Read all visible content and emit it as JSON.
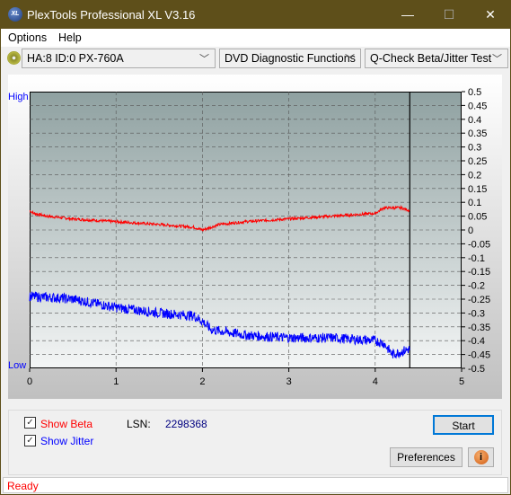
{
  "window": {
    "title": "PlexTools Professional XL V3.16",
    "logo_text": "XL",
    "minimize": "—",
    "maximize": "☐",
    "close": "✕"
  },
  "menu": {
    "options": "Options",
    "help": "Help"
  },
  "toolbar": {
    "drive": "HA:8 ID:0  PX-760A",
    "function": "DVD Diagnostic Functions",
    "test": "Q-Check Beta/Jitter Test"
  },
  "chart_data": {
    "type": "line",
    "left_labels": {
      "top": "High",
      "bottom": "Low"
    },
    "xlim": [
      0,
      5
    ],
    "ylim": [
      -0.5,
      0.5
    ],
    "x_ticks": [
      "0",
      "1",
      "2",
      "3",
      "4",
      "5"
    ],
    "y_ticks": [
      "0.5",
      "0.45",
      "0.4",
      "0.35",
      "0.3",
      "0.25",
      "0.2",
      "0.15",
      "0.1",
      "0.05",
      "0",
      "-0.05",
      "-0.1",
      "-0.15",
      "-0.2",
      "-0.25",
      "-0.3",
      "-0.35",
      "-0.4",
      "-0.45",
      "-0.5"
    ],
    "grid": true,
    "cursor_x": 4.4,
    "series": [
      {
        "key": "beta",
        "color": "#ff0000",
        "x": [
          0,
          0.05,
          0.2,
          0.5,
          1,
          1.5,
          1.9,
          2,
          2.2,
          2.5,
          3,
          3.5,
          4,
          4.1,
          4.3,
          4.4
        ],
        "y": [
          0.07,
          0.06,
          0.05,
          0.04,
          0.03,
          0.02,
          0.01,
          0.0,
          0.02,
          0.03,
          0.04,
          0.05,
          0.06,
          0.08,
          0.08,
          0.07
        ]
      },
      {
        "key": "jitter",
        "color": "#0000ff",
        "x": [
          0,
          0.3,
          0.5,
          1,
          1.5,
          1.9,
          2.0,
          2.1,
          2.5,
          3,
          3.5,
          4,
          4.1,
          4.15,
          4.2,
          4.3,
          4.4
        ],
        "y": [
          -0.24,
          -0.245,
          -0.25,
          -0.28,
          -0.3,
          -0.31,
          -0.33,
          -0.36,
          -0.38,
          -0.39,
          -0.39,
          -0.4,
          -0.41,
          -0.43,
          -0.45,
          -0.44,
          -0.43
        ]
      }
    ]
  },
  "controls": {
    "show_beta": "Show Beta",
    "show_jitter": "Show Jitter",
    "show_beta_checked": true,
    "show_jitter_checked": true,
    "lsn_label": "LSN:",
    "lsn_value": "2298368",
    "start": "Start",
    "preferences": "Preferences",
    "info_icon": "i"
  },
  "status": "Ready"
}
